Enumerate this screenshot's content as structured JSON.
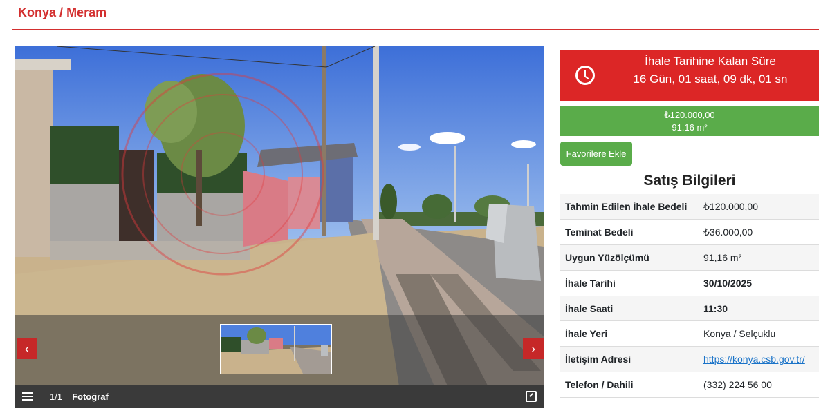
{
  "breadcrumb": {
    "city": "Konya",
    "separator": "/",
    "district": "Meram"
  },
  "gallery": {
    "counter": "1/1",
    "label": "Fotoğraf",
    "prev": "‹",
    "next": "›"
  },
  "countdown": {
    "title": "İhale Tarihine Kalan Süre",
    "value": "16 Gün, 01 saat, 09 dk, 01 sn"
  },
  "price": {
    "amount": "₺120.000,00",
    "area": "91,16 m²"
  },
  "favorites_button": "Favorilere Ekle",
  "sale_info": {
    "title": "Satış Bilgileri",
    "rows": [
      {
        "key": "Tahmin Edilen İhale Bedeli",
        "value": "₺120.000,00"
      },
      {
        "key": "Teminat Bedeli",
        "value": "₺36.000,00"
      },
      {
        "key": "Uygun Yüzölçümü",
        "value": "91,16 m²"
      },
      {
        "key": "İhale Tarihi",
        "value": "30/10/2025"
      },
      {
        "key": "İhale Saati",
        "value": "11:30"
      },
      {
        "key": "İhale Yeri",
        "value": "Konya / Selçuklu"
      },
      {
        "key": "İletişim Adresi",
        "value": "https://konya.csb.gov.tr/"
      },
      {
        "key": "Telefon / Dahili",
        "value": "(332) 224 56 00"
      }
    ]
  },
  "colors": {
    "accent_red": "#dc2626",
    "accent_green": "#5aac4a",
    "link": "#1a73c8"
  },
  "icons": [
    "clock-icon",
    "menu-icon",
    "expand-icon",
    "chevron-left-icon",
    "chevron-right-icon"
  ]
}
